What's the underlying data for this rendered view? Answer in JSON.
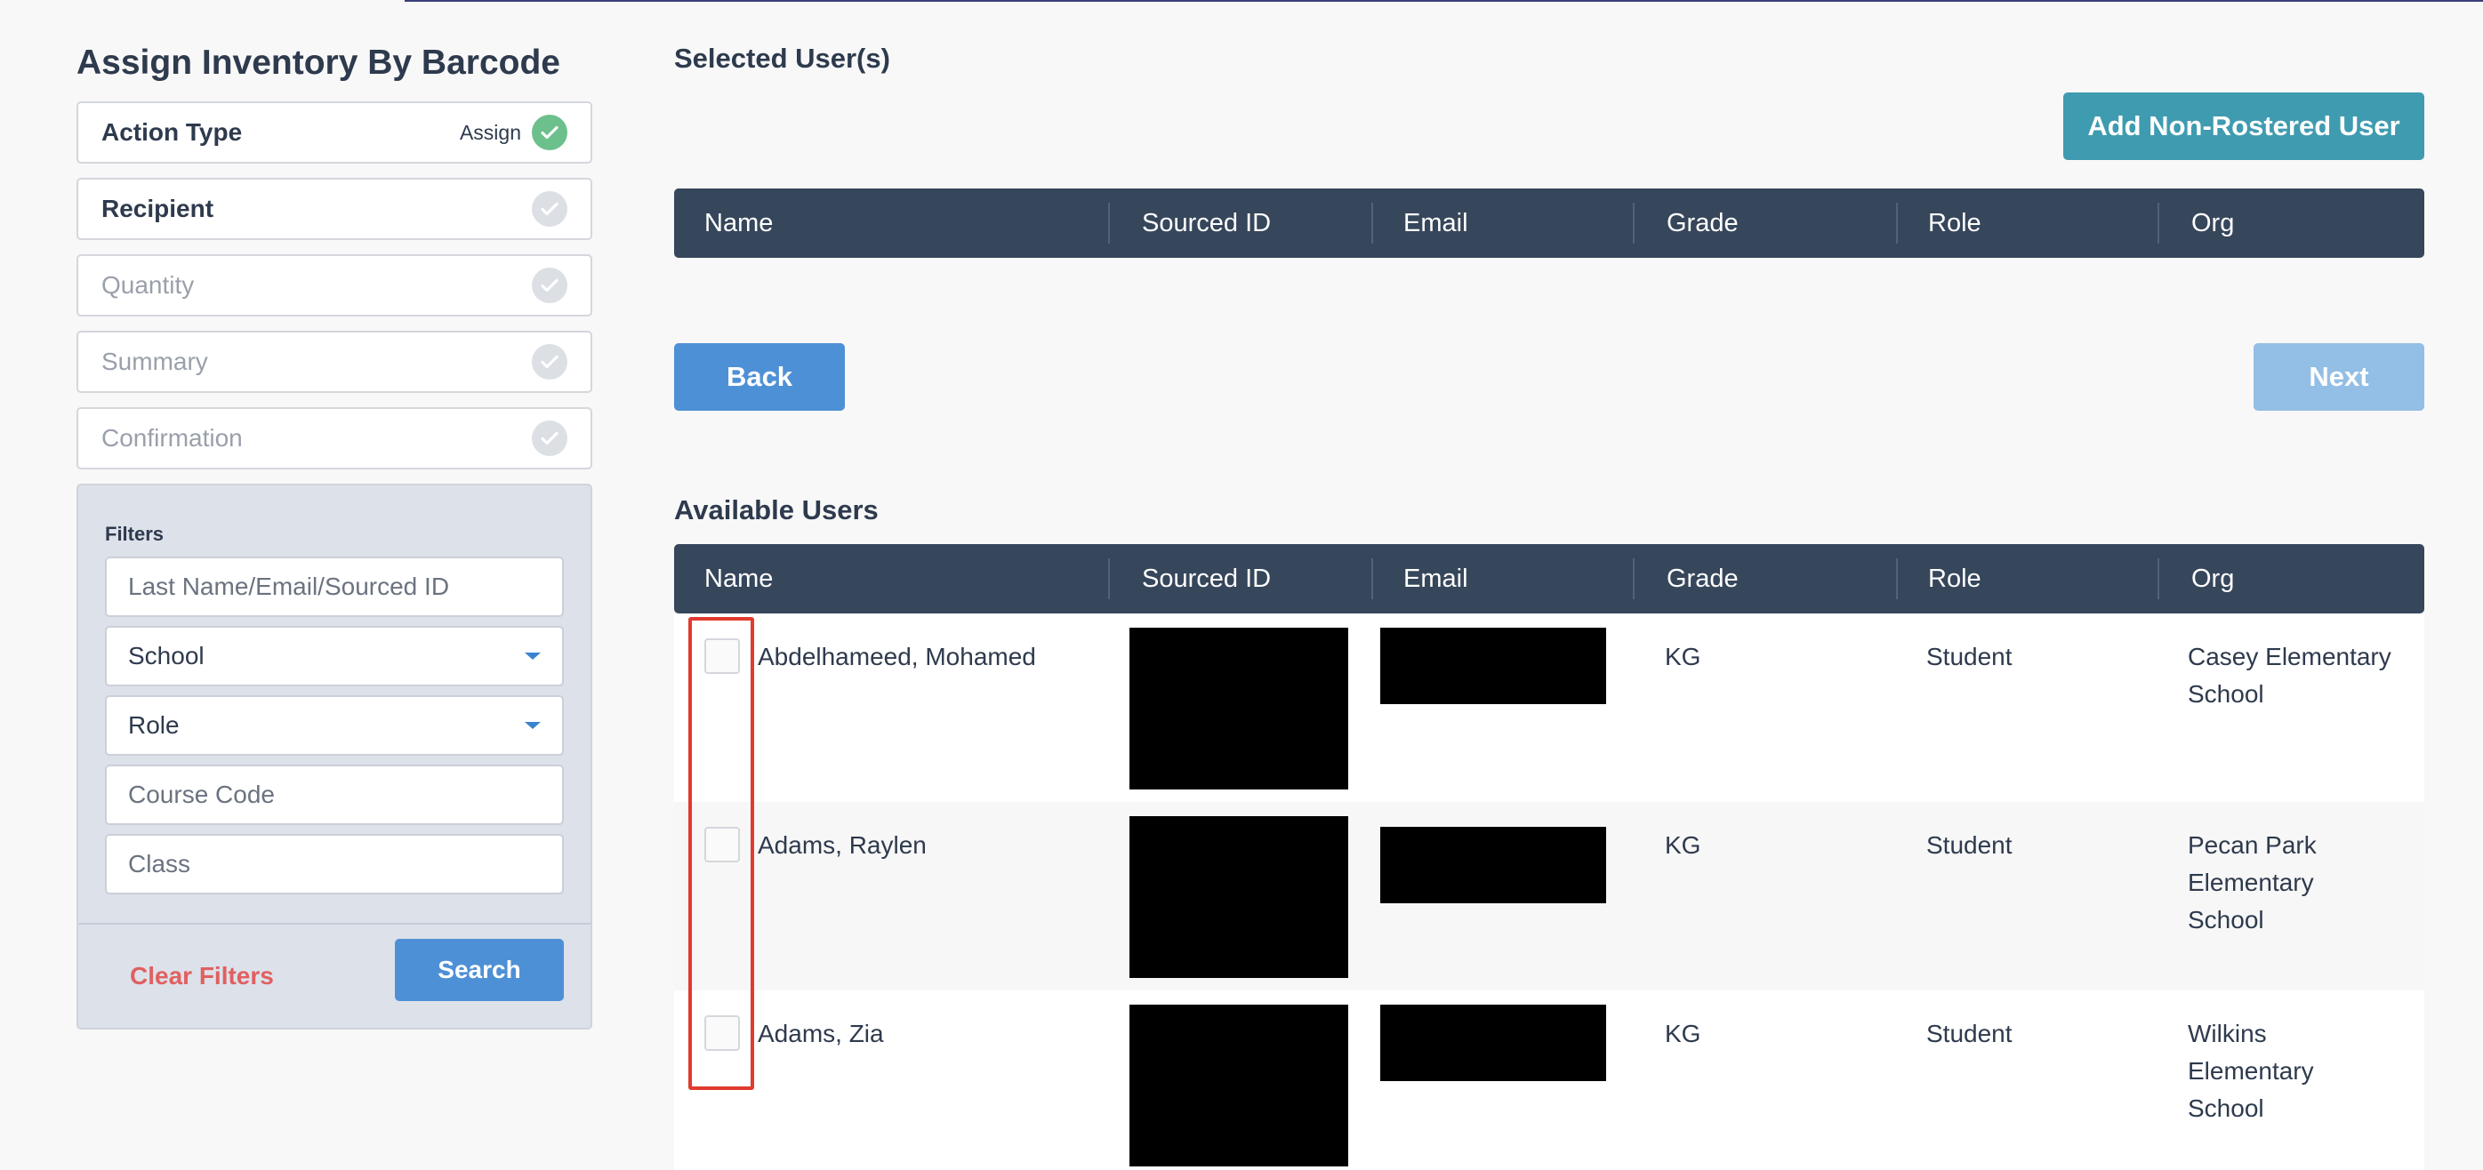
{
  "page_title": "Assign Inventory By Barcode",
  "steps": [
    {
      "label": "Action Type",
      "status": "Assign",
      "state": "done"
    },
    {
      "label": "Recipient",
      "status": "",
      "state": "current"
    },
    {
      "label": "Quantity",
      "status": "",
      "state": "pending"
    },
    {
      "label": "Summary",
      "status": "",
      "state": "pending"
    },
    {
      "label": "Confirmation",
      "status": "",
      "state": "pending"
    }
  ],
  "filters": {
    "title": "Filters",
    "search_placeholder": "Last Name/Email/Sourced ID",
    "school_select": "School",
    "role_select": "Role",
    "course_code_placeholder": "Course Code",
    "class_placeholder": "Class",
    "clear_label": "Clear Filters",
    "search_label": "Search"
  },
  "selected_section": {
    "title": "Selected User(s)",
    "add_button": "Add Non-Rostered User"
  },
  "columns": [
    "Name",
    "Sourced ID",
    "Email",
    "Grade",
    "Role",
    "Org"
  ],
  "nav": {
    "back_label": "Back",
    "next_label": "Next"
  },
  "available_section": {
    "title": "Available Users"
  },
  "users": [
    {
      "name": "Abdelhameed, Mohamed",
      "grade": "KG",
      "role": "Student",
      "org": "Casey Elementary School"
    },
    {
      "name": "Adams, Raylen",
      "grade": "KG",
      "role": "Student",
      "org": "Pecan Park Elementary School"
    },
    {
      "name": "Adams, Zia",
      "grade": "KG",
      "role": "Student",
      "org": "Wilkins Elementary School"
    }
  ],
  "colors": {
    "primary": "#4e90d6",
    "teal": "#3f9bb0",
    "header": "#36465b",
    "done": "#6cc08b",
    "danger": "#e06060",
    "highlight": "#e03b2e"
  }
}
